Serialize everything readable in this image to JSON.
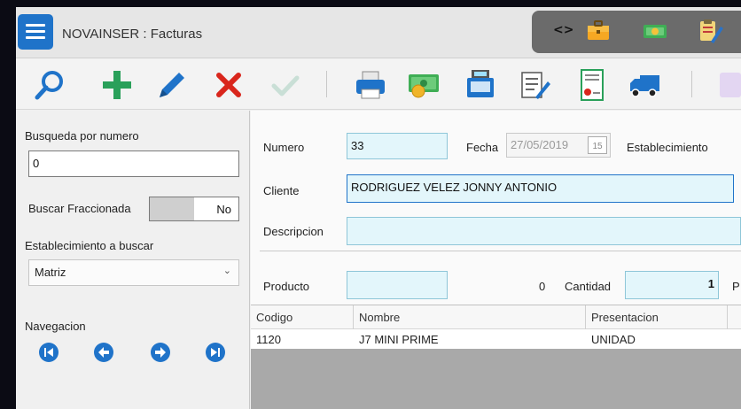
{
  "app": {
    "title": "NOVAINSER  : Facturas"
  },
  "titlebar_right": {
    "code_toggle": "<>"
  },
  "search": {
    "label": "Busqueda por numero",
    "value": "0",
    "fraccionada_label": "Buscar Fraccionada",
    "fraccionada_value": "No",
    "establecimiento_label": "Establecimiento a buscar",
    "establecimiento_value": "Matriz",
    "navegacion_label": "Navegacion"
  },
  "form": {
    "numero_label": "Numero",
    "numero_value": "33",
    "fecha_label": "Fecha",
    "fecha_value": "27/05/2019",
    "cal_day": "15",
    "establecimiento_label": "Establecimiento",
    "cliente_label": "Cliente",
    "cliente_value": "RODRIGUEZ VELEZ JONNY ANTONIO",
    "descripcion_label": "Descripcion",
    "descripcion_value": "",
    "producto_label": "Producto",
    "producto_value": "",
    "producto_count": "0",
    "cantidad_label": "Cantidad",
    "cantidad_value": "1",
    "cut_label": "P"
  },
  "grid": {
    "columns": [
      "Codigo",
      "Nombre",
      "Presentacion"
    ],
    "rows": [
      [
        "1120",
        "J7 MINI PRIME",
        "UNIDAD"
      ]
    ]
  },
  "colors": {
    "accent": "#1f73c9",
    "add": "#2aa05a",
    "delete": "#d9261c",
    "input_bg": "#e3f6fb"
  }
}
